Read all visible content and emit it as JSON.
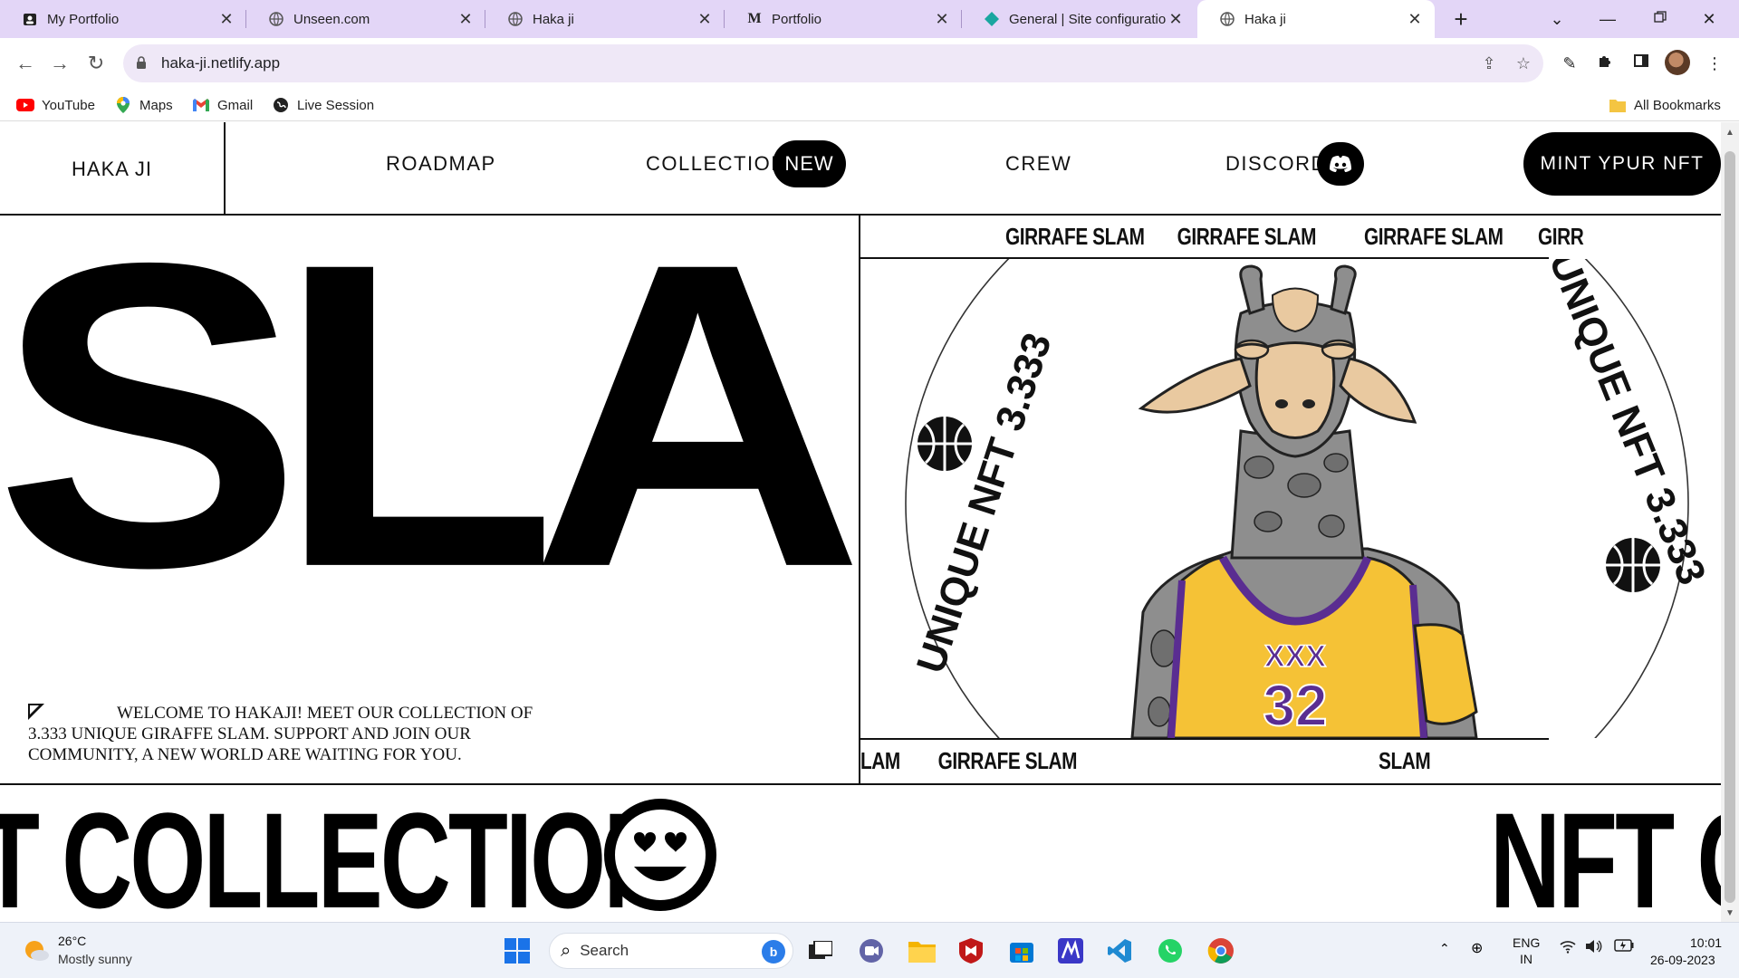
{
  "browser": {
    "tabs": [
      {
        "title": "My Portfolio",
        "icon": "portfolio-favicon"
      },
      {
        "title": "Unseen.com",
        "icon": "globe-favicon"
      },
      {
        "title": "Haka ji",
        "icon": "globe-favicon"
      },
      {
        "title": "Portfolio",
        "icon": "m-favicon"
      },
      {
        "title": "General | Site configuration",
        "icon": "netlify-favicon"
      },
      {
        "title": "Haka ji",
        "icon": "globe-favicon",
        "active": true
      }
    ],
    "new_tab_label": "+",
    "url": "haka-ji.netlify.app",
    "bookmarks": [
      {
        "label": "YouTube",
        "icon": "youtube-icon"
      },
      {
        "label": "Maps",
        "icon": "maps-icon"
      },
      {
        "label": "Gmail",
        "icon": "gmail-icon"
      },
      {
        "label": "Live Session",
        "icon": "globe-icon"
      }
    ],
    "all_bookmarks": "All Bookmarks"
  },
  "site": {
    "brand": "HAKA JI",
    "nav": {
      "roadmap": "ROADMAP",
      "collection": "COLLECTION",
      "collection_badge": "NEW",
      "crew": "CREW",
      "discord": "DISCORD"
    },
    "cta": "MINT YPUR NFT",
    "hero_big_text": "SLAM SLAM",
    "intro": "WELCOME TO HAKAJI! MEET OUR COLLECTION OF 3.333 UNIQUE GIRAFFE SLAM. SUPPORT AND JOIN OUR COMMUNITY, A NEW WORLD ARE WAITING FOR YOU.",
    "marquee_top": [
      "GIRRAFE SLAM",
      "GIRRAFE SLAM",
      "GIRRAFE SLAM",
      "GIRR"
    ],
    "marquee_bottom": [
      "LAM",
      "GIRRAFE SLAM",
      "SLAM"
    ],
    "ring_text": "UNIQUE NFT 3.333",
    "jersey_number": "32",
    "jersey_mark": "XXX",
    "band_left": "T COLLECTION",
    "band_right": "NFT C"
  },
  "taskbar": {
    "weather_temp": "26°C",
    "weather_desc": "Mostly sunny",
    "search_placeholder": "Search",
    "lang_top": "ENG",
    "lang_bottom": "IN",
    "time": "10:01",
    "date": "26-09-2023"
  },
  "colors": {
    "tabstrip": "#e3d6f7",
    "jersey_yellow": "#f5c236",
    "jersey_purple": "#5a2d91",
    "giraffe_gray": "#8e8e8e",
    "giraffe_tan": "#e9c9a0"
  }
}
